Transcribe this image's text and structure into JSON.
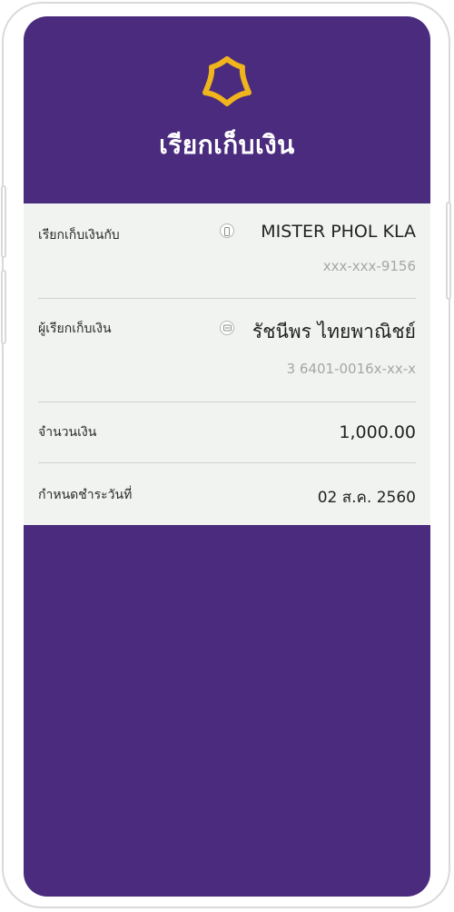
{
  "header": {
    "title": "เรียกเก็บเงิน",
    "logo_icon": "scb-bank-logo-icon",
    "accent_color": "#f0b41c",
    "background_color": "#4a2b7d"
  },
  "request": {
    "payer_label": "เรียกเก็บเงินกับ",
    "payer_icon": "mobile-phone-icon",
    "payer_name": "MISTER PHOL  KLA",
    "payer_phone": "xxx-xxx-9156",
    "requester_label": "ผู้เรียกเก็บเงิน",
    "requester_icon": "id-card-icon",
    "requester_name": "รัชนีพร ไทยพาณิชย์",
    "requester_id": "3 6401-0016x-xx-x",
    "amount_label": "จำนวนเงิน",
    "amount_value": "1,000.00",
    "due_label": "กำหนดชำระวันที่",
    "due_value": "02 ส.ค. 2560"
  }
}
